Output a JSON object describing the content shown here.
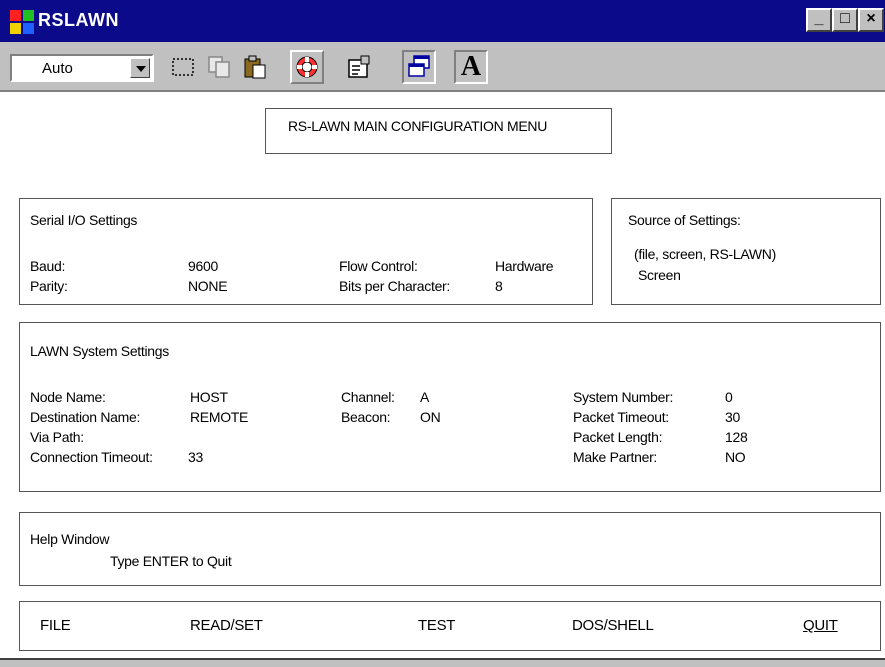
{
  "window": {
    "title": "RSLAWN"
  },
  "titlebar_buttons": {
    "minimize": "_",
    "maximize": "□",
    "close": "×"
  },
  "toolbar": {
    "font_size_value": "Auto",
    "font_button_label": "A"
  },
  "menu_title": "RS-LAWN MAIN CONFIGURATION MENU",
  "serial": {
    "heading": "Serial I/O Settings",
    "baud_label": "Baud:",
    "baud_value": "9600",
    "parity_label": "Parity:",
    "parity_value": "NONE",
    "flow_label": "Flow Control:",
    "flow_value": "Hardware",
    "bits_label": "Bits per Character:",
    "bits_value": "8"
  },
  "source": {
    "heading": "Source of Settings:",
    "options": "(file, screen, RS-LAWN)",
    "value": "Screen"
  },
  "lawn": {
    "heading": "LAWN System Settings",
    "node_label": "Node Name:",
    "node_value": "HOST",
    "dest_label": "Destination Name:",
    "dest_value": "REMOTE",
    "via_label": "Via Path:",
    "timeout_label": "Connection Timeout:",
    "timeout_value": "33",
    "channel_label": "Channel:",
    "channel_value": "A",
    "beacon_label": "Beacon:",
    "beacon_value": "ON",
    "sysnum_label": "System Number:",
    "sysnum_value": "0",
    "pkt_timeout_label": "Packet Timeout:",
    "pkt_timeout_value": "30",
    "pkt_length_label": "Packet Length:",
    "pkt_length_value": "128",
    "partner_label": "Make Partner:",
    "partner_value": "NO"
  },
  "help": {
    "heading": "Help Window",
    "text": "Type ENTER to Quit"
  },
  "menu": {
    "file": "FILE",
    "readset": "READ/SET",
    "test": "TEST",
    "dosshell": "DOS/SHELL",
    "quit": "QUIT"
  }
}
